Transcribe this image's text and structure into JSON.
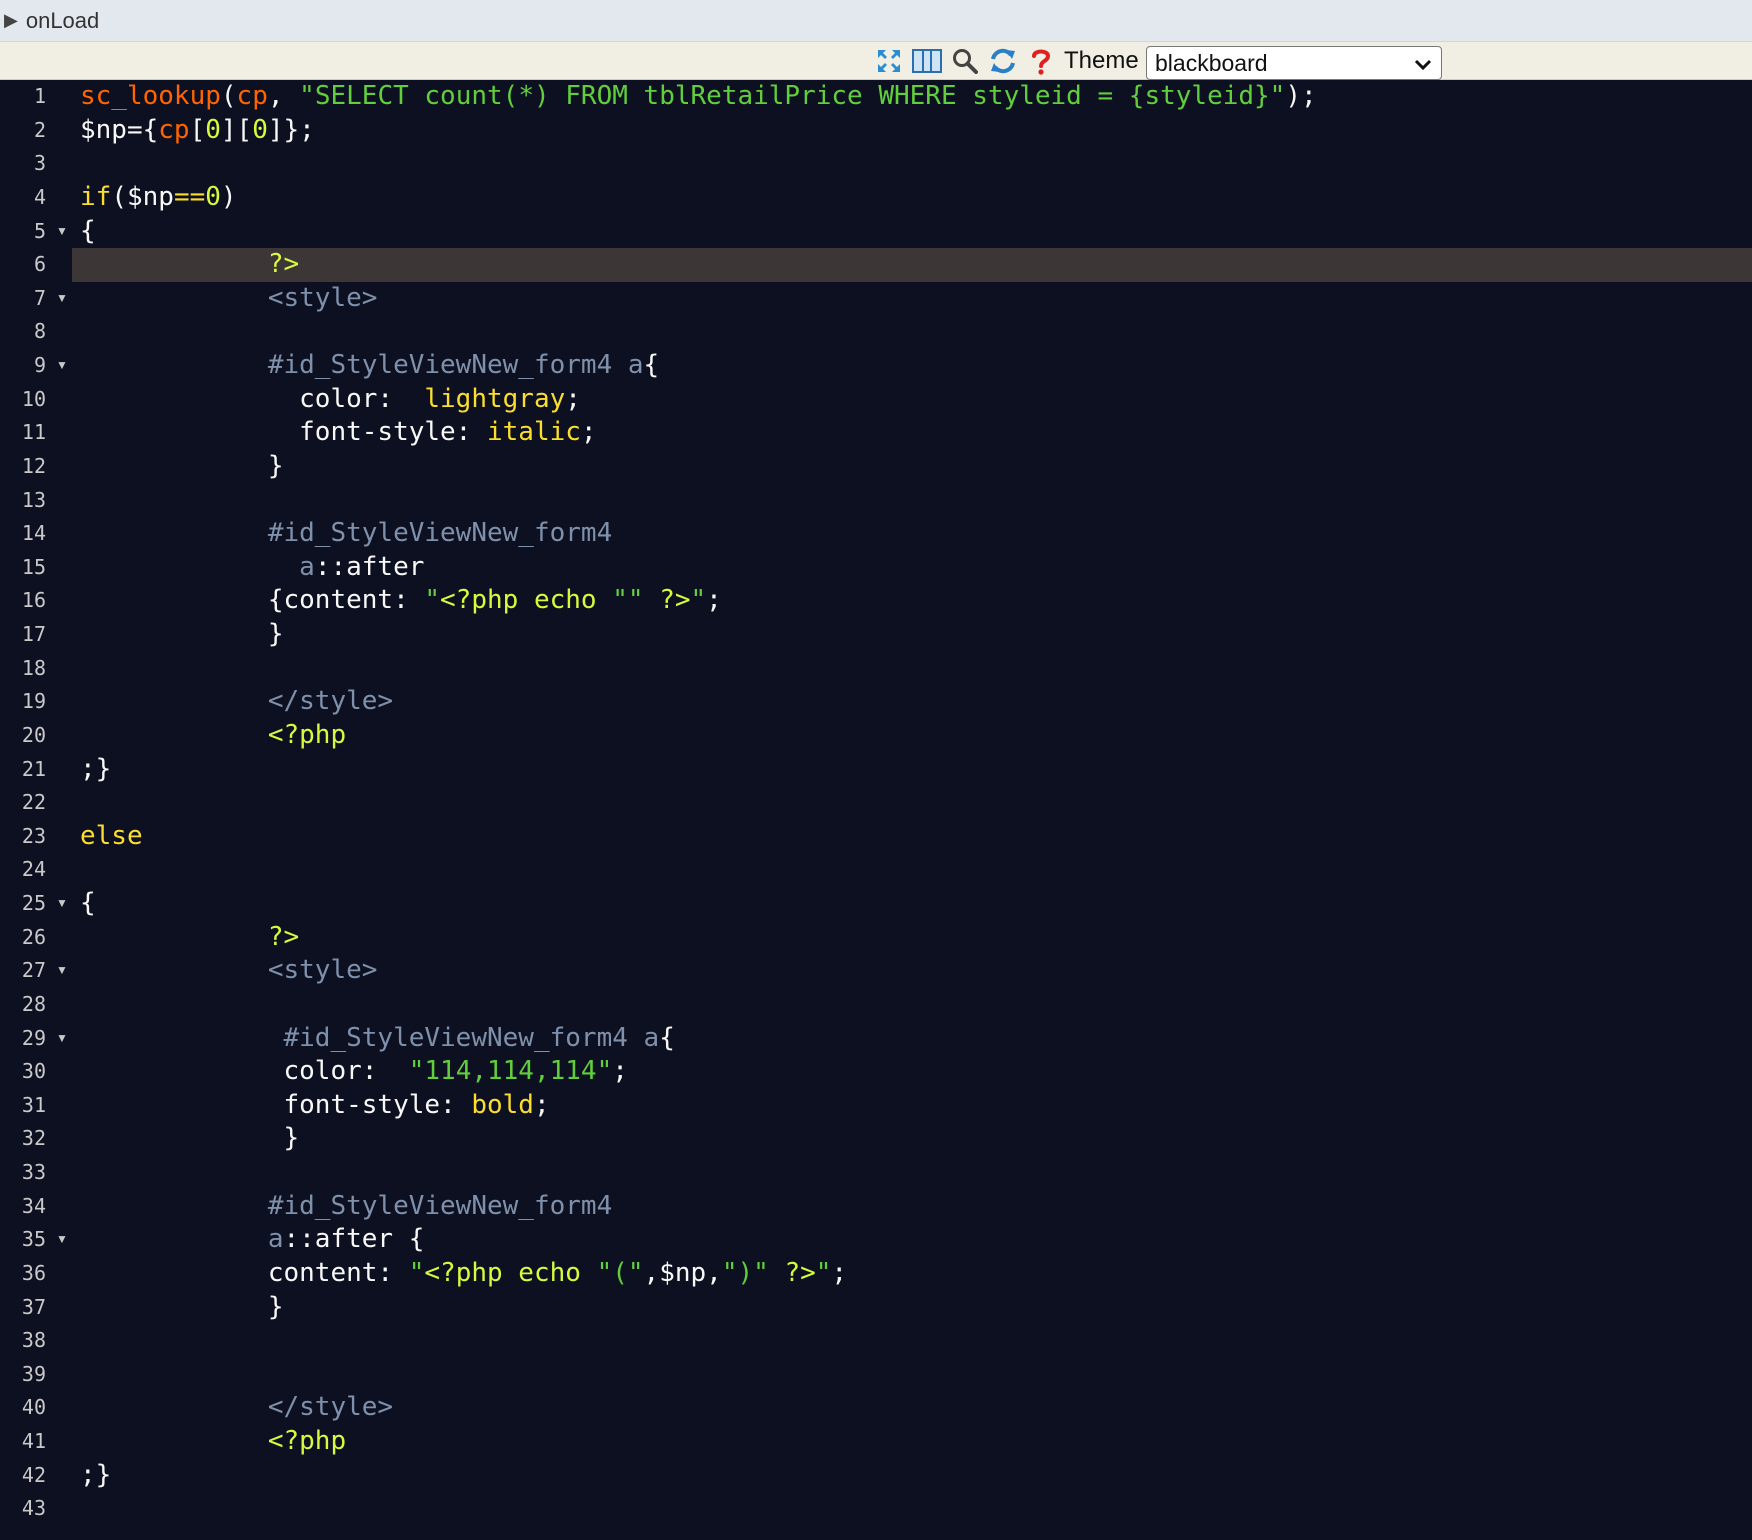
{
  "header": {
    "toggle_glyph": "▶",
    "event_name": "onLoad"
  },
  "toolbar": {
    "icons": [
      "fullscreen-icon",
      "columns-icon",
      "search-icon",
      "refresh-icon",
      "help-icon"
    ],
    "theme_label": "Theme",
    "theme_value": "blackboard"
  },
  "editor": {
    "active_line": 6,
    "fold_lines": [
      5,
      7,
      9,
      25,
      27,
      29,
      35
    ],
    "lines": [
      [
        [
          "fn",
          "sc_lookup"
        ],
        [
          "pl",
          "("
        ],
        [
          "fn",
          "cp"
        ],
        [
          "pl",
          ", "
        ],
        [
          "str",
          "\"SELECT count(*) FROM tblRetailPrice WHERE styleid = {styleid}\""
        ],
        [
          "pl",
          ");"
        ]
      ],
      [
        [
          "pl",
          "$np={"
        ],
        [
          "fn",
          "cp"
        ],
        [
          "pl",
          "["
        ],
        [
          "num",
          "0"
        ],
        [
          "pl",
          "]["
        ],
        [
          "num",
          "0"
        ],
        [
          "pl",
          "]};"
        ]
      ],
      [],
      [
        [
          "kw",
          "if"
        ],
        [
          "pl",
          "($np"
        ],
        [
          "kw",
          "=="
        ],
        [
          "num",
          "0"
        ],
        [
          "pl",
          ")"
        ]
      ],
      [
        [
          "pl",
          "{"
        ]
      ],
      [
        [
          "pl",
          "            "
        ],
        [
          "php",
          "?>"
        ]
      ],
      [
        [
          "pl",
          "            "
        ],
        [
          "tag",
          "<style>"
        ]
      ],
      [],
      [
        [
          "pl",
          "            "
        ],
        [
          "tag",
          "#id_StyleViewNew_form4 a"
        ],
        [
          "pl",
          "{"
        ]
      ],
      [
        [
          "pl",
          "              color:  "
        ],
        [
          "val",
          "lightgray"
        ],
        [
          "pl",
          ";"
        ]
      ],
      [
        [
          "pl",
          "              font-style: "
        ],
        [
          "val",
          "italic"
        ],
        [
          "pl",
          ";"
        ]
      ],
      [
        [
          "pl",
          "            }"
        ]
      ],
      [],
      [
        [
          "pl",
          "            "
        ],
        [
          "tag",
          "#id_StyleViewNew_form4"
        ]
      ],
      [
        [
          "pl",
          "              "
        ],
        [
          "tag",
          "a"
        ],
        [
          "pl",
          "::after"
        ]
      ],
      [
        [
          "pl",
          "            {content: "
        ],
        [
          "str",
          "\""
        ],
        [
          "php",
          "<?php echo "
        ],
        [
          "str",
          "\"\" "
        ],
        [
          "php",
          "?>"
        ],
        [
          "str",
          "\""
        ],
        [
          "pl",
          ";"
        ]
      ],
      [
        [
          "pl",
          "            }"
        ]
      ],
      [],
      [
        [
          "pl",
          "            "
        ],
        [
          "tag",
          "</style>"
        ]
      ],
      [
        [
          "pl",
          "            "
        ],
        [
          "php",
          "<?php"
        ]
      ],
      [
        [
          "pl",
          ";}"
        ]
      ],
      [],
      [
        [
          "kw",
          "else"
        ]
      ],
      [],
      [
        [
          "pl",
          "{"
        ]
      ],
      [
        [
          "pl",
          "            "
        ],
        [
          "php",
          "?>"
        ]
      ],
      [
        [
          "pl",
          "            "
        ],
        [
          "tag",
          "<style>"
        ]
      ],
      [],
      [
        [
          "pl",
          "             "
        ],
        [
          "tag",
          "#id_StyleViewNew_form4 a"
        ],
        [
          "pl",
          "{"
        ]
      ],
      [
        [
          "pl",
          "             color:  "
        ],
        [
          "str",
          "\"114,114,114\""
        ],
        [
          "pl",
          ";"
        ]
      ],
      [
        [
          "pl",
          "             font-style: "
        ],
        [
          "val",
          "bold"
        ],
        [
          "pl",
          ";"
        ]
      ],
      [
        [
          "pl",
          "             }"
        ]
      ],
      [],
      [
        [
          "pl",
          "            "
        ],
        [
          "tag",
          "#id_StyleViewNew_form4"
        ]
      ],
      [
        [
          "pl",
          "            "
        ],
        [
          "tag",
          "a"
        ],
        [
          "pl",
          "::after {"
        ]
      ],
      [
        [
          "pl",
          "            content: "
        ],
        [
          "str",
          "\""
        ],
        [
          "php",
          "<?php echo "
        ],
        [
          "str",
          "\"(\""
        ],
        [
          "pl",
          ",$np,"
        ],
        [
          "str",
          "\")\" "
        ],
        [
          "php",
          "?>"
        ],
        [
          "str",
          "\""
        ],
        [
          "pl",
          ";"
        ]
      ],
      [
        [
          "pl",
          "            }"
        ]
      ],
      [],
      [],
      [
        [
          "pl",
          "            "
        ],
        [
          "tag",
          "</style>"
        ]
      ],
      [
        [
          "pl",
          "            "
        ],
        [
          "php",
          "<?php"
        ]
      ],
      [
        [
          "pl",
          ";}"
        ]
      ],
      []
    ]
  }
}
